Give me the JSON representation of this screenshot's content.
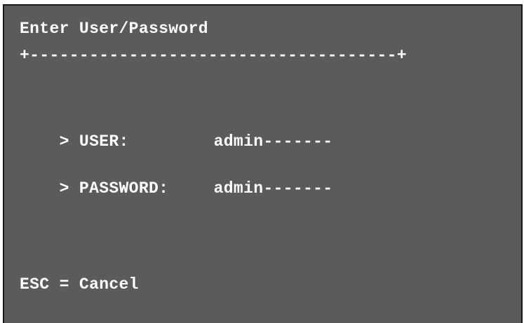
{
  "screen": {
    "title": "Enter User/Password",
    "border_line": "+-------------------------------------+",
    "colors": {
      "background": "#5b5b5b",
      "text": "#ffffff",
      "frame": "#1a1a1a"
    }
  },
  "fields": {
    "user": {
      "prompt": "> USER:",
      "value": "admin-------"
    },
    "password": {
      "prompt": "> PASSWORD:",
      "value": "admin-------"
    }
  },
  "footer": {
    "hint": "ESC = Cancel"
  }
}
